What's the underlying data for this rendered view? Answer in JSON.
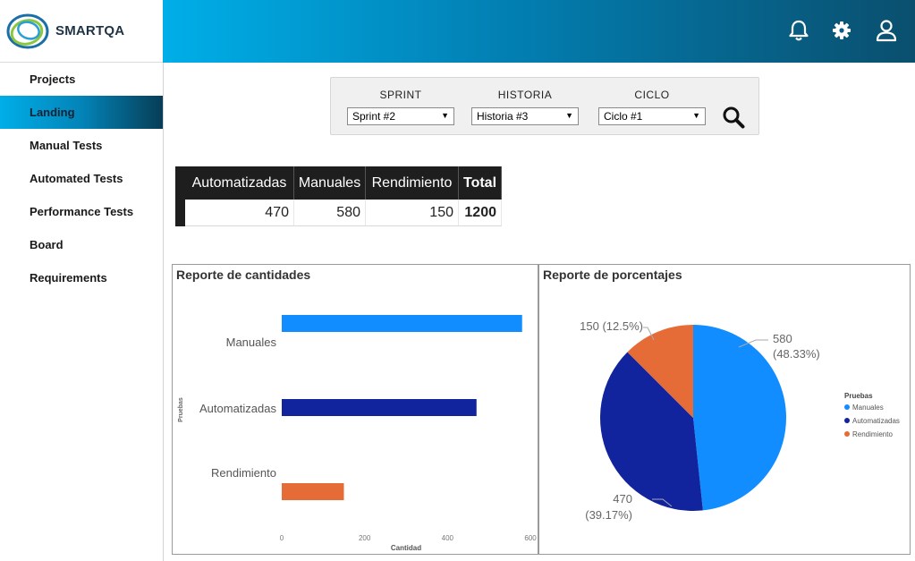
{
  "app": {
    "name": "SMARTQA"
  },
  "header": {
    "icons": [
      "bell-icon",
      "gear-icon",
      "user-icon"
    ]
  },
  "sidebar": {
    "items": [
      {
        "label": "Projects",
        "active": false
      },
      {
        "label": "Landing",
        "active": true
      },
      {
        "label": "Manual Tests",
        "active": false
      },
      {
        "label": "Automated Tests",
        "active": false
      },
      {
        "label": "Performance Tests",
        "active": false
      },
      {
        "label": "Board",
        "active": false
      },
      {
        "label": "Requirements",
        "active": false
      }
    ]
  },
  "filters": {
    "sprint": {
      "label": "SPRINT",
      "value": "Sprint #2"
    },
    "historia": {
      "label": "HISTORIA",
      "value": "Historia #3"
    },
    "ciclo": {
      "label": "CICLO",
      "value": "Ciclo #1"
    },
    "search_icon": "search-icon"
  },
  "summary": {
    "headers": [
      "Automatizadas",
      "Manuales",
      "Rendimiento",
      "Total"
    ],
    "values": [
      "470",
      "580",
      "150",
      "1200"
    ]
  },
  "colors": {
    "manuales": "#118dff",
    "automatizadas": "#12239e",
    "rendimiento": "#e66c37"
  },
  "chart_data": [
    {
      "type": "bar",
      "title": "Reporte de cantidades",
      "xlabel": "Cantidad",
      "ylabel": "Pruebas",
      "categories": [
        "Manuales",
        "Automatizadas",
        "Rendimiento"
      ],
      "values": [
        580,
        470,
        150
      ],
      "xlim": [
        0,
        600
      ],
      "ticks": [
        "0",
        "200",
        "400",
        "600"
      ],
      "colors": [
        "#118dff",
        "#12239e",
        "#e66c37"
      ]
    },
    {
      "type": "pie",
      "title": "Reporte de porcentajes",
      "legend_title": "Pruebas",
      "legend_position": "right",
      "slices": [
        {
          "name": "Manuales",
          "value": 580,
          "label_value": "580",
          "label_pct": "(48.33%)",
          "color": "#118dff"
        },
        {
          "name": "Automatizadas",
          "value": 470,
          "label_value": "470",
          "label_pct": "(39.17%)",
          "color": "#12239e"
        },
        {
          "name": "Rendimiento",
          "value": 150,
          "label_value": "150 (12.5%)",
          "label_pct": "",
          "color": "#e66c37"
        }
      ]
    }
  ]
}
